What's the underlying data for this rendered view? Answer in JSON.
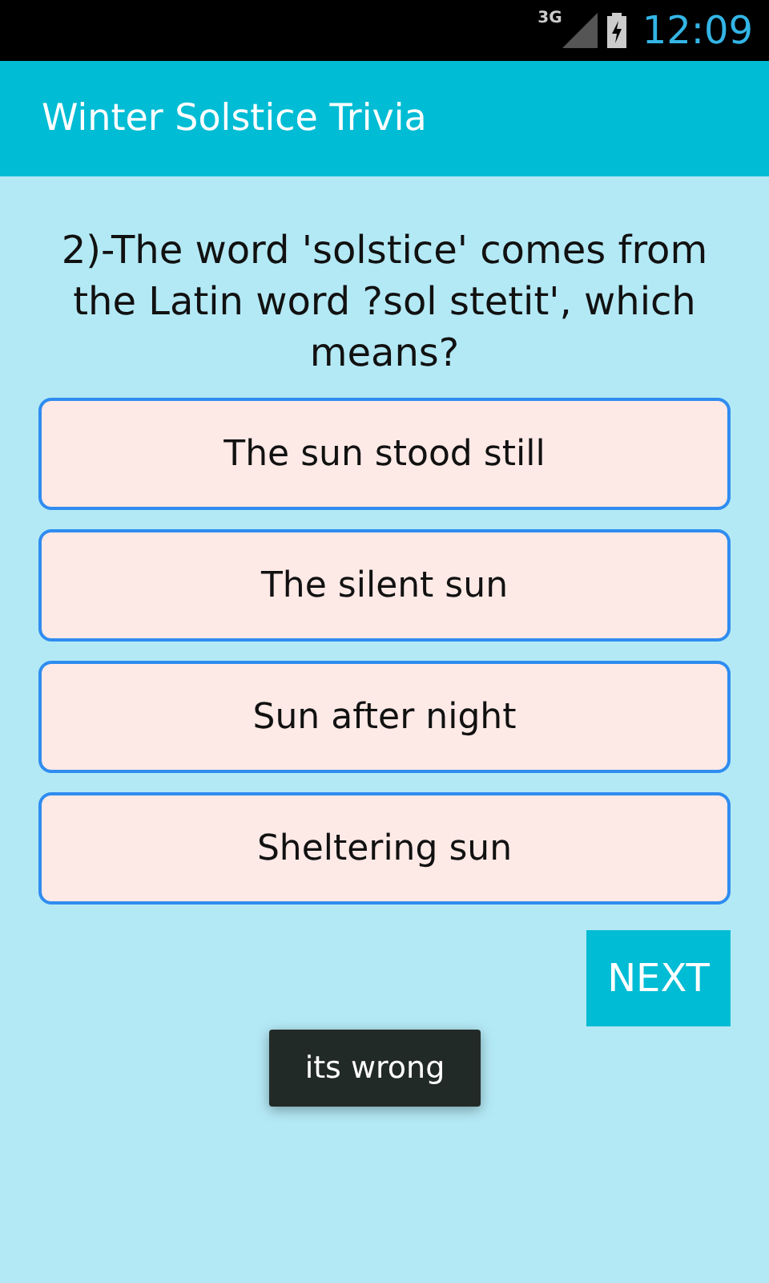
{
  "status_bar": {
    "network": "3G",
    "time": "12:09"
  },
  "app_bar": {
    "title": "Winter Solstice Trivia"
  },
  "question": "2)-The word 'solstice' comes from the Latin word ?sol stetit', which means?",
  "options": [
    {
      "label": "The sun stood still"
    },
    {
      "label": "The silent sun"
    },
    {
      "label": "Sun after night"
    },
    {
      "label": "Sheltering sun"
    }
  ],
  "next_button": "NEXT",
  "toast": "its wrong"
}
